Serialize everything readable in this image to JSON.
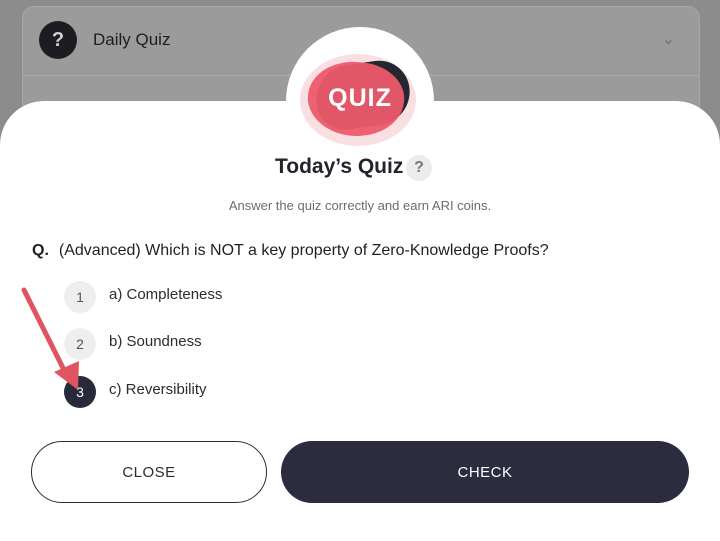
{
  "background": {
    "card_title": "Daily Quiz",
    "card_icon": "question-icon",
    "chevron_icon": "chevron-down-icon"
  },
  "modal": {
    "logo_text": "QUIZ",
    "title": "Today’s Quiz",
    "help_icon_glyph": "?",
    "subtitle": "Answer the quiz correctly and earn ARI coins.",
    "question_prefix": "Q.",
    "question_text": "(Advanced) Which is NOT a key property of Zero-Knowledge Proofs?",
    "options": [
      {
        "number": "1",
        "label": "a) Completeness",
        "selected": false
      },
      {
        "number": "2",
        "label": "b) Soundness",
        "selected": false
      },
      {
        "number": "3",
        "label": "c) Reversibility",
        "selected": true
      }
    ],
    "close_label": "CLOSE",
    "check_label": "CHECK"
  },
  "colors": {
    "accent_dark": "#2b2d3f",
    "logo_pink": "#ec5a6c",
    "arrow_red": "#e0555f"
  }
}
